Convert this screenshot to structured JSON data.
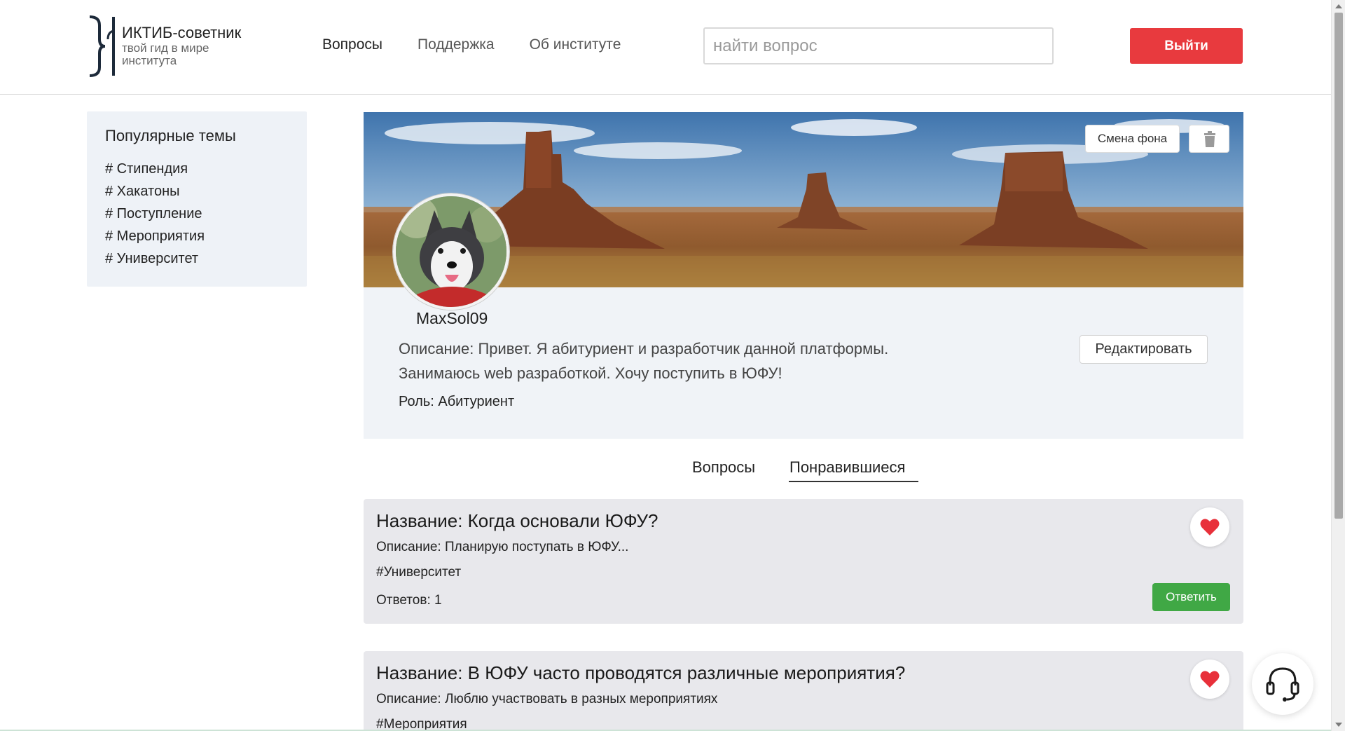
{
  "brand": {
    "title": "ИКТИБ-советник",
    "subtitle": "твой гид в мире института"
  },
  "nav": {
    "items": [
      {
        "label": "Вопросы",
        "active": true
      },
      {
        "label": "Поддержка",
        "active": false
      },
      {
        "label": "Об институте",
        "active": false
      }
    ]
  },
  "search": {
    "placeholder": "найти вопрос",
    "value": ""
  },
  "header": {
    "logout_label": "Выйти"
  },
  "sidebar": {
    "title": "Популярные темы",
    "topics": [
      "# Стипендия",
      "# Хакатоны",
      "# Поступление",
      "# Мероприятия",
      "# Университет"
    ]
  },
  "profile": {
    "change_bg_label": "Смена фона",
    "username": "MaxSol09",
    "description": "Описание:  Привет. Я абитуриент и разработчик данной платформы. Занимаюсь web разработкой. Хочу поступить в ЮФУ!",
    "role": "Роль: Абитуриент",
    "edit_label": "Редактировать"
  },
  "tabs": {
    "questions": "Вопросы",
    "liked": "Понравившиеся",
    "selected": "liked"
  },
  "cards": [
    {
      "title": "Название: Когда основали ЮФУ?",
      "description": "Описание: Планирую поступать в ЮФУ...",
      "tag": "#Университет",
      "answers": "Ответов: 1",
      "reply_label": "Ответить",
      "liked": true
    },
    {
      "title": "Название: В ЮФУ часто проводятся различные мероприятия?",
      "description": "Описание: Люблю участвовать в разных мероприятиях",
      "tag": "#Мероприятия",
      "liked": true
    }
  ],
  "colors": {
    "accent_red": "#e83a3e",
    "reply_green": "#40a845",
    "heart": "#e8303a",
    "panel_bg": "#eef2f7"
  },
  "icons": {
    "trash": "trash-icon",
    "heart": "heart-icon",
    "support": "headset-icon"
  }
}
